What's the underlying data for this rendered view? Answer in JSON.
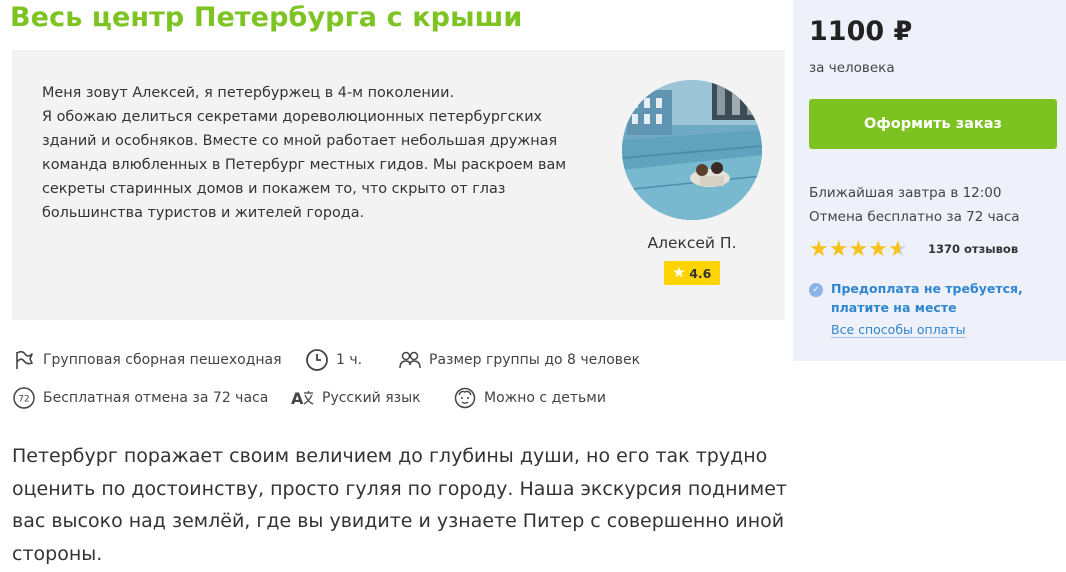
{
  "title": "Весь центр Петербурга с крыши",
  "guide": {
    "bio_lines": [
      "Меня зовут Алексей, я петербуржец в 4-м поколении.",
      "Я обожаю делиться секретами дореволюционных петербургских",
      "зданий и особняков. Вместе со мной работает небольшая дружная",
      "команда влюбленных в Петербург местных гидов. Мы раскроем вам",
      "секреты старинных домов и покажем то, что скрыто от глаз",
      "большинства туристов и жителей города."
    ],
    "name": "Алексей П.",
    "rating": "4.6",
    "rating_icon": "star-icon"
  },
  "features": [
    {
      "icon": "flag-icon",
      "label": "Групповая сборная пешеходная"
    },
    {
      "icon": "clock-icon",
      "label": "1 ч."
    },
    {
      "icon": "people-icon",
      "label": "Размер группы до 8 человек"
    },
    {
      "icon": "cancel-72-icon",
      "label": "Бесплатная отмена за 72 часа",
      "icon_text": "72"
    },
    {
      "icon": "language-icon",
      "label": "Русский язык"
    },
    {
      "icon": "child-face-icon",
      "label": "Можно с детьми"
    }
  ],
  "description_lines": [
    "Петербург поражает своим величием до глубины души, но его так трудно",
    "оценить по достоинству, просто гуляя по городу. Наша экскурсия поднимет",
    "вас высоко над землёй, где вы увидите и узнаете Питер с совершенно иной",
    "стороны."
  ],
  "sidebar": {
    "price": "1100 ₽",
    "per": "за человека",
    "order_label": "Оформить заказ",
    "nearest": "Ближайшая завтра в 12:00",
    "cancel": "Отмена бесплатно за 72 часа",
    "rating_value": 4.6,
    "reviews": "1370 отзывов",
    "prepay": "Предоплата не требуется, платите на месте",
    "pay_link": "Все способы оплаты"
  },
  "colors": {
    "accent_green": "#7cc322",
    "title_green": "#7dc321",
    "star_yellow": "#fed500",
    "link_blue": "#2f86d0",
    "sidebar_bg": "#eef1fa"
  }
}
